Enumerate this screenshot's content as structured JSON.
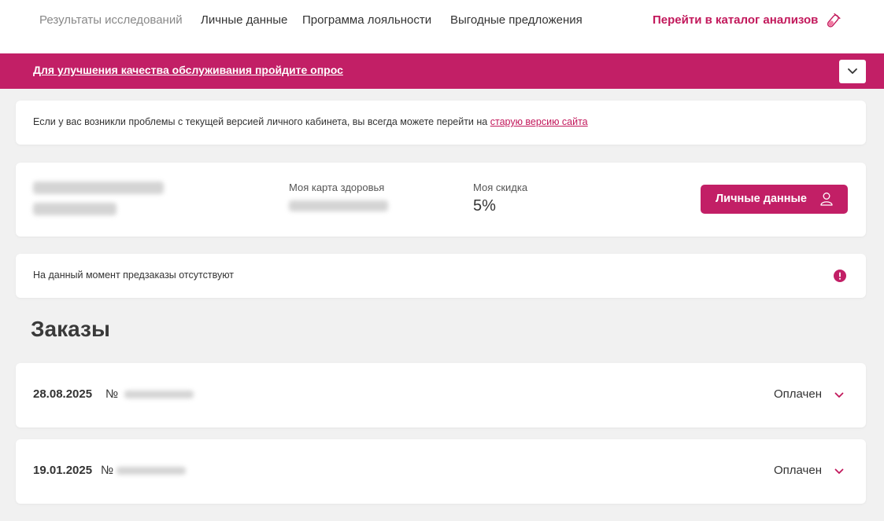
{
  "nav": {
    "items": [
      {
        "label": "Результаты исследований",
        "active": true
      },
      {
        "label": "Личные данные",
        "active": false
      },
      {
        "label": "Программа лояльности",
        "active": false
      },
      {
        "label": "Выгодные предложения",
        "active": false
      }
    ],
    "catalog_label": "Перейти в каталог анализов",
    "catalog_icon": "test-tube-icon"
  },
  "banner": {
    "text": "Для улучшения качества обслуживания пройдите опрос",
    "toggle_icon": "chevron-down-icon"
  },
  "notice": {
    "text": "Если у вас возникли проблемы с текущей версией личного кабинета, вы всегда можете перейти на",
    "link": "старую версию сайта"
  },
  "profile": {
    "card_label": "Моя карта здоровья",
    "discount_label": "Моя скидка",
    "discount_value": "5%",
    "button_label": "Личные данные",
    "button_icon": "user-icon"
  },
  "preorders": {
    "text": "На данный момент предзаказы отсутствуют",
    "icon": "alert-icon"
  },
  "orders": {
    "title": "Заказы",
    "items": [
      {
        "date": "28.08.2025",
        "no_label": "№",
        "status": "Оплачен"
      },
      {
        "date": "19.01.2025",
        "no_label": "№",
        "status": "Оплачен"
      }
    ]
  },
  "colors": {
    "accent": "#c21f66",
    "background": "#f1f1f1"
  }
}
